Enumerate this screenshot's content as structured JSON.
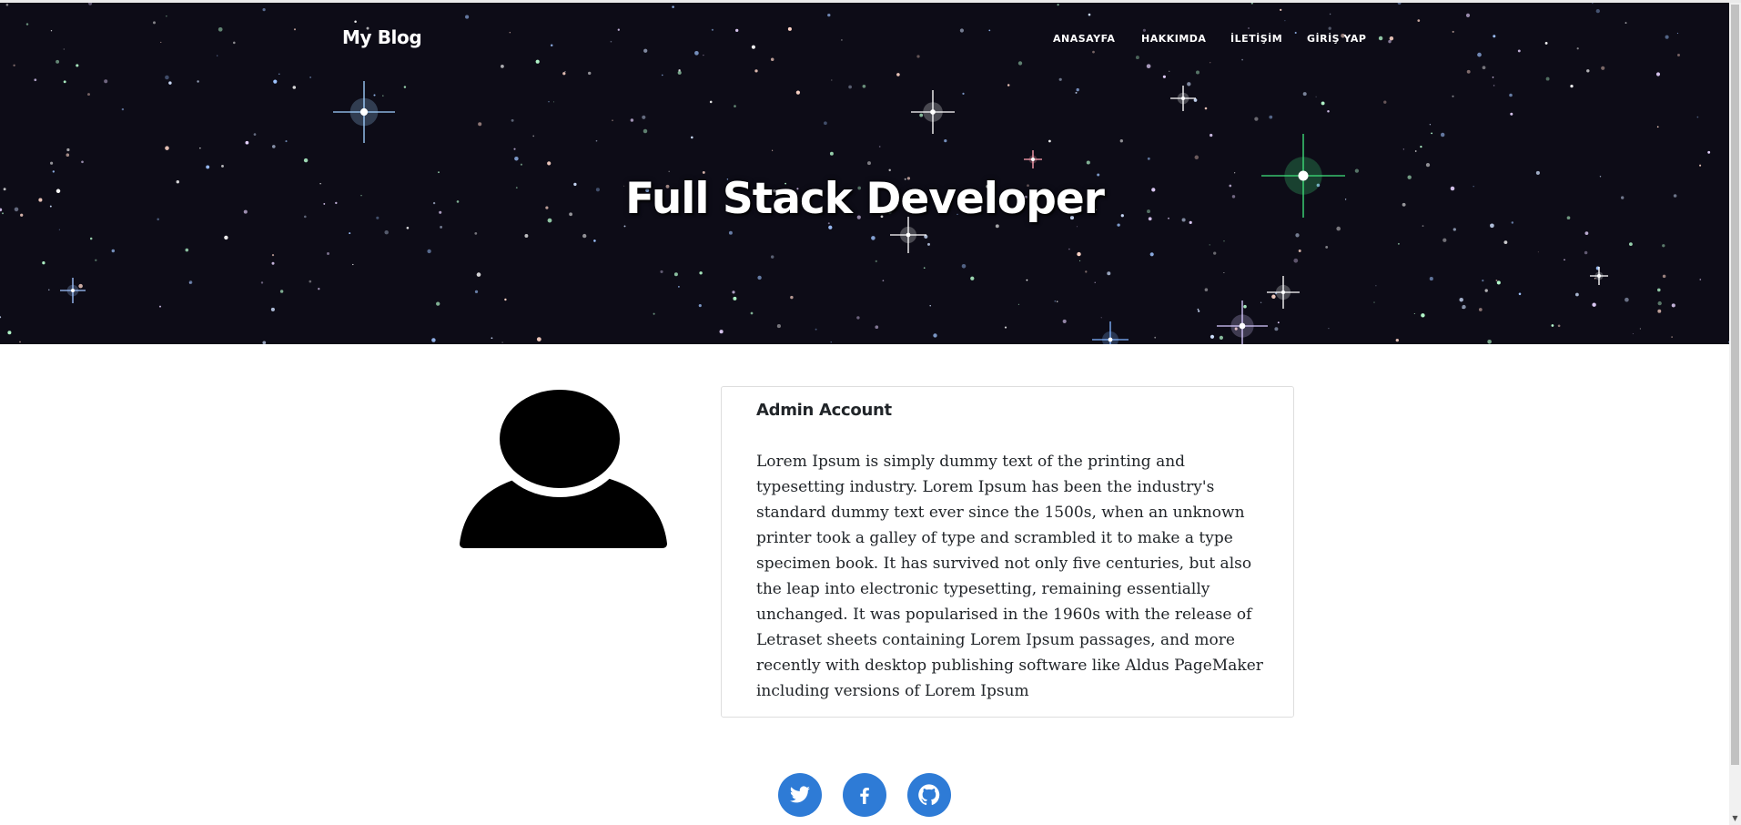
{
  "navbar": {
    "brand": "My Blog",
    "links": [
      {
        "label": "ANASAYFA"
      },
      {
        "label": "HAKKIMDA"
      },
      {
        "label": "İLETİŞİM"
      },
      {
        "label": "GİRİŞ YAP"
      }
    ]
  },
  "hero": {
    "title": "Full Stack Developer"
  },
  "profile": {
    "avatar_icon": "user-silhouette-icon",
    "card_title": "Admin Account",
    "card_text": "Lorem Ipsum is simply dummy text of the printing and typesetting industry. Lorem Ipsum has been the industry's standard dummy text ever since the 1500s, when an unknown printer took a galley of type and scrambled it to make a type specimen book. It has survived not only five centuries, but also the leap into electronic typesetting, remaining essentially unchanged. It was popularised in the 1960s with the release of Letraset sheets containing Lorem Ipsum passages, and more recently with desktop publishing software like Aldus PageMaker including versions of Lorem Ipsum"
  },
  "social": [
    {
      "icon": "twitter-icon"
    },
    {
      "icon": "facebook-icon"
    },
    {
      "icon": "github-icon"
    }
  ],
  "colors": {
    "hero_background": "#0d0c17",
    "social_button": "#2e7bd6",
    "text": "#212529"
  }
}
